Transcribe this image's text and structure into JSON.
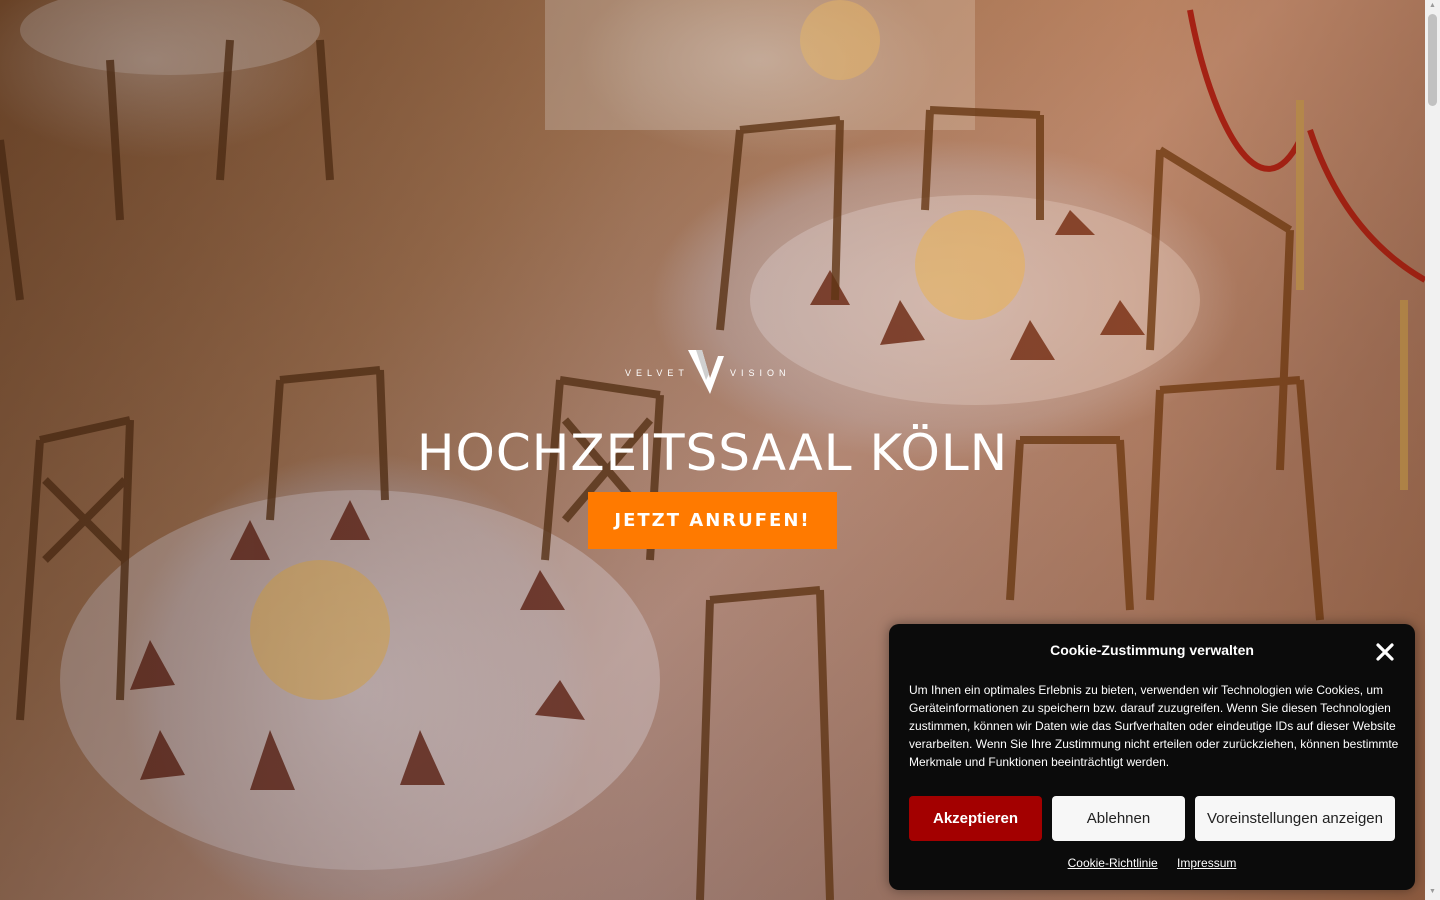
{
  "brand": {
    "word_left": "VELVET",
    "word_right": "VISION",
    "logo_icon": "v-monogram-icon"
  },
  "hero": {
    "title": "HOCHZEITSSAAL KÖLN",
    "cta_label": "JETZT ANRUFEN!",
    "cta_color": "#ff7a00"
  },
  "cookie": {
    "title": "Cookie-Zustimmung verwalten",
    "close_icon": "close-icon",
    "text": "Um Ihnen ein optimales Erlebnis zu bieten, verwenden wir Technologien wie Cookies, um Geräteinformationen zu speichern bzw. darauf zuzugreifen. Wenn Sie diesen Technologien zustimmen, können wir Daten wie das Surfverhalten oder eindeutige IDs auf dieser Website verarbeiten. Wenn Sie Ihre Zustimmung nicht erteilen oder zurückziehen, können bestimmte Merkmale und Funktionen beeinträchtigt werden.",
    "accept_label": "Akzeptieren",
    "deny_label": "Ablehnen",
    "prefs_label": "Voreinstellungen anzeigen",
    "link_policy": "Cookie-Richtlinie",
    "link_imprint": "Impressum",
    "accept_color": "#a30000"
  }
}
